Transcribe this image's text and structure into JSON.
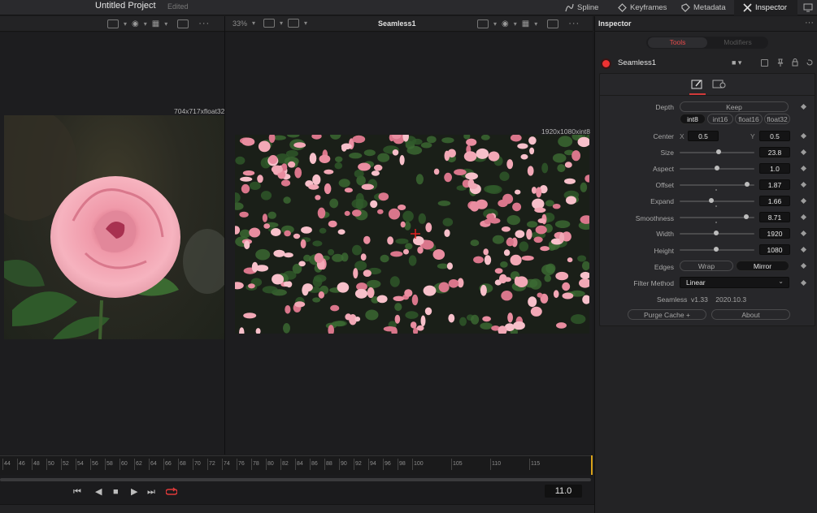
{
  "app": {
    "project_title": "Untitled Project",
    "project_status": "Edited",
    "nav": [
      {
        "label": "Spline",
        "icon": "spline-icon"
      },
      {
        "label": "Keyframes",
        "icon": "keyframes-icon"
      },
      {
        "label": "Metadata",
        "icon": "metadata-icon"
      },
      {
        "label": "Inspector",
        "icon": "inspector-icon"
      }
    ]
  },
  "viewer": {
    "zoom": "33%",
    "title": "Seamless1",
    "left_resolution": "704x717xfloat32",
    "right_resolution": "1920x1080xint8"
  },
  "timeline": {
    "ticks": [
      "44",
      "46",
      "48",
      "50",
      "52",
      "54",
      "56",
      "58",
      "60",
      "62",
      "64",
      "66",
      "68",
      "70",
      "72",
      "74",
      "76",
      "78",
      "80",
      "82",
      "84",
      "86",
      "88",
      "90",
      "92",
      "94",
      "96",
      "98",
      "100",
      "105",
      "110",
      "115"
    ],
    "current_frame": "11.0"
  },
  "inspector": {
    "title": "Inspector",
    "tabs": {
      "tools": "Tools",
      "modifiers": "Modifiers"
    },
    "node_name": "Seamless1",
    "params": {
      "depth_label": "Depth",
      "depth_keep": "Keep",
      "depth_options": [
        "int8",
        "int16",
        "float16",
        "float32"
      ],
      "center_label": "Center",
      "center_x_label": "X",
      "center_x": "0.5",
      "center_y_label": "Y",
      "center_y": "0.5",
      "size_label": "Size",
      "size": "23.8",
      "aspect_label": "Aspect",
      "aspect": "1.0",
      "offset_label": "Offset",
      "offset": "1.87",
      "expand_label": "Expand",
      "expand": "1.66",
      "smoothness_label": "Smoothness",
      "smoothness": "8.71",
      "width_label": "Width",
      "width": "1920",
      "height_label": "Height",
      "height": "1080",
      "edges_label": "Edges",
      "edges_wrap": "Wrap",
      "edges_mirror": "Mirror",
      "filter_label": "Filter Method",
      "filter_value": "Linear",
      "version": "Seamless  v1.33    2020.10.3",
      "purge_button": "Purge Cache +",
      "about_button": "About"
    }
  }
}
